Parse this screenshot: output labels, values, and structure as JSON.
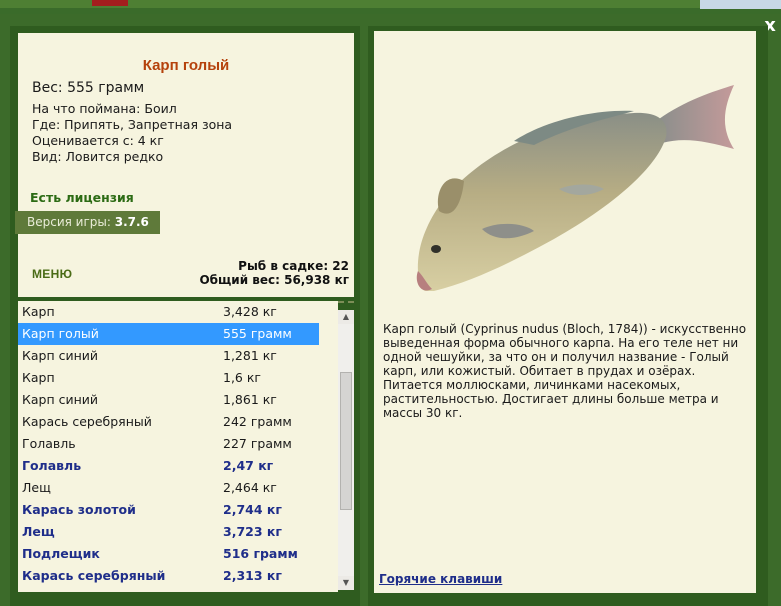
{
  "close_label": "x",
  "fish": {
    "title": "Карп голый",
    "weight": "Вес: 555 грамм",
    "details": [
      "На что поймана: Боил",
      "Где: Припять, Запретная зона",
      "Оценивается с: 4 кг",
      "Вид: Ловится редко"
    ]
  },
  "license": "Есть лицензия",
  "version": {
    "label": "Версия игры: ",
    "number": "3.7.6"
  },
  "menu_label": "МЕНЮ",
  "stats": {
    "fish_count": "Рыб в садке: 22",
    "total_weight": "Общий вес: 56,938 кг"
  },
  "catch_list": [
    {
      "name": "Карп",
      "weight": "3,428 кг",
      "bold": false,
      "selected": false
    },
    {
      "name": "Карп голый",
      "weight": "555 грамм",
      "bold": false,
      "selected": true
    },
    {
      "name": "Карп синий",
      "weight": "1,281 кг",
      "bold": false,
      "selected": false
    },
    {
      "name": "Карп",
      "weight": "1,6 кг",
      "bold": false,
      "selected": false
    },
    {
      "name": "Карп синий",
      "weight": "1,861 кг",
      "bold": false,
      "selected": false
    },
    {
      "name": "Карась серебряный",
      "weight": "242 грамм",
      "bold": false,
      "selected": false
    },
    {
      "name": "Голавль",
      "weight": "227 грамм",
      "bold": false,
      "selected": false
    },
    {
      "name": "Голавль",
      "weight": "2,47 кг",
      "bold": true,
      "selected": false
    },
    {
      "name": "Лещ",
      "weight": "2,464 кг",
      "bold": false,
      "selected": false
    },
    {
      "name": "Карась золотой",
      "weight": "2,744 кг",
      "bold": true,
      "selected": false
    },
    {
      "name": "Лещ",
      "weight": "3,723 кг",
      "bold": true,
      "selected": false
    },
    {
      "name": "Подлещик",
      "weight": "516 грамм",
      "bold": true,
      "selected": false
    },
    {
      "name": "Карась серебряный",
      "weight": "2,313 кг",
      "bold": true,
      "selected": false
    }
  ],
  "description": "Карп голый (Cyprinus nudus (Bloch, 1784)) - искусственно выведенная форма обычного карпа. На его теле нет ни одной чешуйки, за что он и получил название - Голый карп, или кожистый. Обитает в прудах и озёрах. Питается моллюсками, личинками насекомых, растительностью. Достигает длины больше метра и массы 30 кг.",
  "hotkeys_label": "Горячие клавиши",
  "icons": {
    "close": "close-icon",
    "scroll_up": "arrow-up-icon",
    "scroll_down": "arrow-down-icon",
    "fish_image": "fish-image"
  },
  "colors": {
    "frame_green": "#2f5c1f",
    "panel_bg": "#f6f4df",
    "title_orange": "#b5420c",
    "license_green": "#2c6b14",
    "selected_blue": "#3399ff",
    "bold_row_blue": "#1f2e8a"
  }
}
